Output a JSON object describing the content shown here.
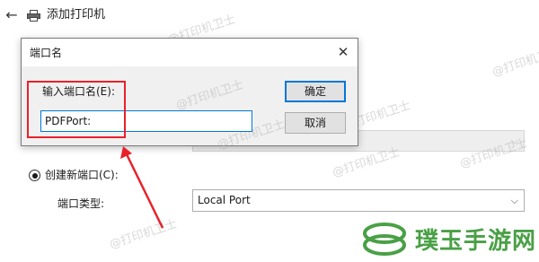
{
  "wizard": {
    "back_glyph": "←",
    "title": "添加打印机",
    "create_port_label": "创建新端口(C):",
    "port_type_label": "端口类型:",
    "port_type_value": "Local Port",
    "chevron": "⌵"
  },
  "dialog": {
    "title": "端口名",
    "close_glyph": "✕",
    "field_label": "输入端口名(E):",
    "field_value": "PDFPort:",
    "ok_label": "确定",
    "cancel_label": "取消"
  },
  "watermarks": {
    "text": "@打印机卫士"
  },
  "logo": {
    "text": "璞玉手游网"
  },
  "colors": {
    "accent": "#0078d7",
    "annotation": "#e8222b",
    "logo_green": "#4aa046"
  },
  "icons": {
    "printer": "printer-icon",
    "back": "back-arrow-icon",
    "close": "close-icon"
  }
}
